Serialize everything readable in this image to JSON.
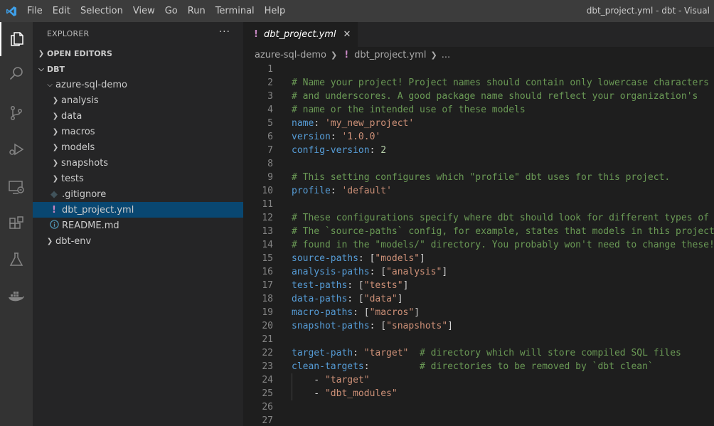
{
  "titlebar": {
    "menu": [
      "File",
      "Edit",
      "Selection",
      "View",
      "Go",
      "Run",
      "Terminal",
      "Help"
    ],
    "window_title": "dbt_project.yml - dbt - Visual"
  },
  "activity_bar": [
    "explorer-icon",
    "search-icon",
    "source-control-icon",
    "run-debug-icon",
    "remote-explorer-icon",
    "extensions-icon",
    "testing-icon",
    "docker-icon"
  ],
  "sidebar": {
    "header": "EXPLORER",
    "more": "···",
    "open_editors": "OPEN EDITORS",
    "root": "DBT",
    "folder": "azure-sql-demo",
    "items": [
      {
        "label": "analysis",
        "type": "folder"
      },
      {
        "label": "data",
        "type": "folder"
      },
      {
        "label": "macros",
        "type": "folder"
      },
      {
        "label": "models",
        "type": "folder"
      },
      {
        "label": "snapshots",
        "type": "folder"
      },
      {
        "label": "tests",
        "type": "folder"
      },
      {
        "label": ".gitignore",
        "type": "gitignore"
      },
      {
        "label": "dbt_project.yml",
        "type": "yaml",
        "selected": true
      },
      {
        "label": "README.md",
        "type": "info"
      }
    ],
    "env_folder": "dbt-env"
  },
  "editor": {
    "tab_label": "dbt_project.yml",
    "tab_icon": "!",
    "close": "✕",
    "breadcrumb": {
      "folder": "azure-sql-demo",
      "file": "dbt_project.yml",
      "tail": "..."
    },
    "lines": [
      [],
      [
        [
          "c",
          "# Name your project! Project names should contain only lowercase characters"
        ]
      ],
      [
        [
          "c",
          "# and underscores. A good package name should reflect your organization's"
        ]
      ],
      [
        [
          "c",
          "# name or the intended use of these models"
        ]
      ],
      [
        [
          "k",
          "name"
        ],
        [
          "p",
          ": "
        ],
        [
          "s",
          "'my_new_project'"
        ]
      ],
      [
        [
          "k",
          "version"
        ],
        [
          "p",
          ": "
        ],
        [
          "s",
          "'1.0.0'"
        ]
      ],
      [
        [
          "k",
          "config-version"
        ],
        [
          "p",
          ": "
        ],
        [
          "n",
          "2"
        ]
      ],
      [],
      [
        [
          "c",
          "# This setting configures which \"profile\" dbt uses for this project."
        ]
      ],
      [
        [
          "k",
          "profile"
        ],
        [
          "p",
          ": "
        ],
        [
          "s",
          "'default'"
        ]
      ],
      [],
      [
        [
          "c",
          "# These configurations specify where dbt should look for different types of f"
        ]
      ],
      [
        [
          "c",
          "# The `source-paths` config, for example, states that models in this project"
        ]
      ],
      [
        [
          "c",
          "# found in the \"models/\" directory. You probably won't need to change these!"
        ]
      ],
      [
        [
          "k",
          "source-paths"
        ],
        [
          "p",
          ": ["
        ],
        [
          "s",
          "\"models\""
        ],
        [
          "p",
          "]"
        ]
      ],
      [
        [
          "k",
          "analysis-paths"
        ],
        [
          "p",
          ": ["
        ],
        [
          "s",
          "\"analysis\""
        ],
        [
          "p",
          "]"
        ]
      ],
      [
        [
          "k",
          "test-paths"
        ],
        [
          "p",
          ": ["
        ],
        [
          "s",
          "\"tests\""
        ],
        [
          "p",
          "]"
        ]
      ],
      [
        [
          "k",
          "data-paths"
        ],
        [
          "p",
          ": ["
        ],
        [
          "s",
          "\"data\""
        ],
        [
          "p",
          "]"
        ]
      ],
      [
        [
          "k",
          "macro-paths"
        ],
        [
          "p",
          ": ["
        ],
        [
          "s",
          "\"macros\""
        ],
        [
          "p",
          "]"
        ]
      ],
      [
        [
          "k",
          "snapshot-paths"
        ],
        [
          "p",
          ": ["
        ],
        [
          "s",
          "\"snapshots\""
        ],
        [
          "p",
          "]"
        ]
      ],
      [],
      [
        [
          "k",
          "target-path"
        ],
        [
          "p",
          ": "
        ],
        [
          "s",
          "\"target\""
        ],
        [
          "p",
          "  "
        ],
        [
          "c",
          "# directory which will store compiled SQL files"
        ]
      ],
      [
        [
          "k",
          "clean-targets"
        ],
        [
          "p",
          ":         "
        ],
        [
          "c",
          "# directories to be removed by `dbt clean`"
        ]
      ],
      [
        [
          "p",
          "    - "
        ],
        [
          "s",
          "\"target\""
        ]
      ],
      [
        [
          "p",
          "    - "
        ],
        [
          "s",
          "\"dbt_modules\""
        ]
      ],
      [],
      []
    ]
  }
}
